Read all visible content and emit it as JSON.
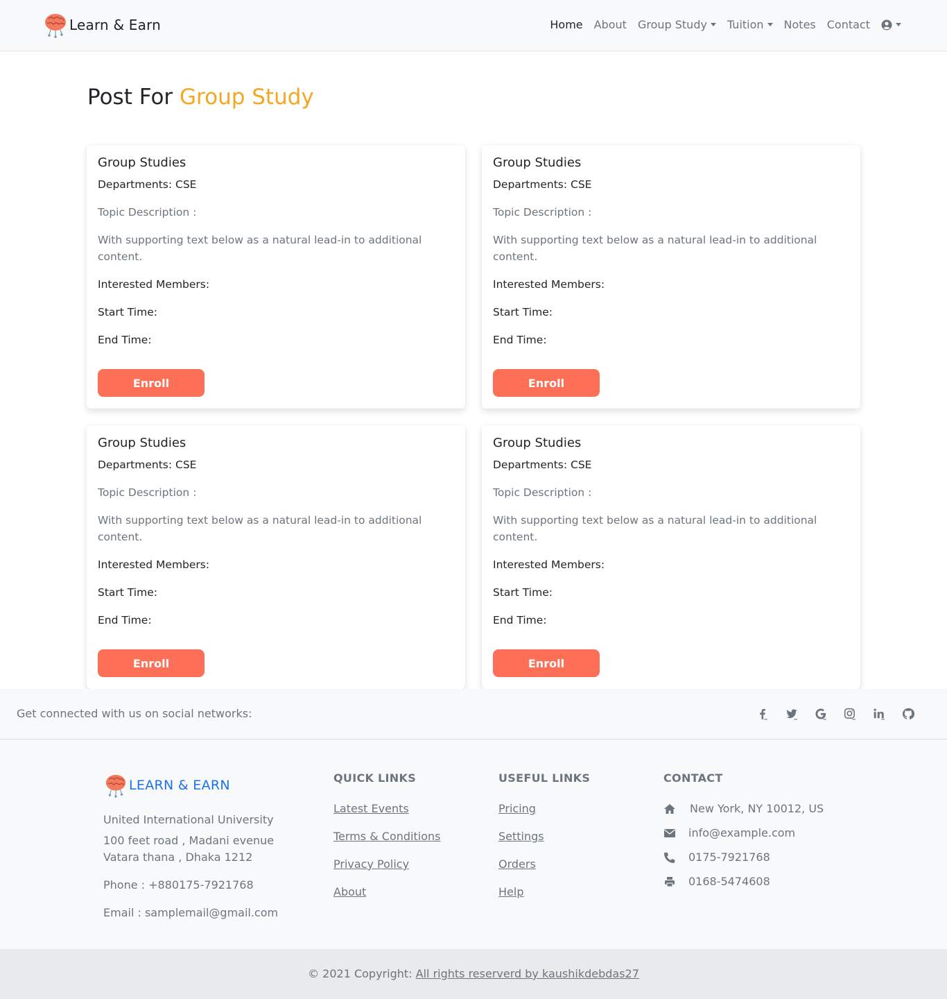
{
  "navbar": {
    "brand": "Learn & Earn",
    "links": [
      "Home",
      "About",
      "Group Study",
      "Tuition",
      "Notes",
      "Contact"
    ]
  },
  "page": {
    "title_prefix": "Post For",
    "title_accent": "Group Study",
    "accent_color": "#f5a623"
  },
  "cards": [
    {
      "title": "Group Studies",
      "department": "Departments: CSE",
      "topic_label": "Topic Description :",
      "description": "With supporting text below as a natural lead-in to additional content.",
      "members_label": "Interested Members:",
      "start_label": "Start Time:",
      "end_label": "End Time:",
      "button": "Enroll"
    },
    {
      "title": "Group Studies",
      "department": "Departments: CSE",
      "topic_label": "Topic Description :",
      "description": "With supporting text below as a natural lead-in to additional content.",
      "members_label": "Interested Members:",
      "start_label": "Start Time:",
      "end_label": "End Time:",
      "button": "Enroll"
    },
    {
      "title": "Group Studies",
      "department": "Departments: CSE",
      "topic_label": "Topic Description :",
      "description": "With supporting text below as a natural lead-in to additional content.",
      "members_label": "Interested Members:",
      "start_label": "Start Time:",
      "end_label": "End Time:",
      "button": "Enroll"
    },
    {
      "title": "Group Studies",
      "department": "Departments: CSE",
      "topic_label": "Topic Description :",
      "description": "With supporting text below as a natural lead-in to additional content.",
      "members_label": "Interested Members:",
      "start_label": "Start Time:",
      "end_label": "End Time:",
      "button": "Enroll"
    }
  ],
  "button_color": "#fd6f56",
  "social": {
    "text": "Get connected with us on social networks:",
    "icons": [
      "facebook-icon",
      "twitter-icon",
      "google-icon",
      "instagram-icon",
      "linkedin-icon",
      "github-icon"
    ]
  },
  "footer": {
    "brand": "LEARN & EARN",
    "brand_color": "#1a73e8",
    "address_lines": [
      "United International University",
      "100 feet road , Madani evenue",
      "Vatara thana , Dhaka 1212"
    ],
    "phone": "Phone : +880175-7921768",
    "email": "Email : samplemail@gmail.com",
    "quick_links": {
      "heading": "QUICK LINKS",
      "items": [
        "Latest Events",
        "Terms & Conditions",
        "Privacy Policy",
        "About"
      ]
    },
    "useful_links": {
      "heading": "USEFUL LINKS",
      "items": [
        "Pricing",
        "Settings",
        "Orders",
        "Help"
      ]
    },
    "contact": {
      "heading": "CONTACT",
      "items": [
        {
          "icon": "home-icon",
          "text": "New York, NY 10012, US"
        },
        {
          "icon": "envelope-icon",
          "text": "info@example.com"
        },
        {
          "icon": "phone-icon",
          "text": "0175-7921768"
        },
        {
          "icon": "printer-icon",
          "text": "0168-5474608"
        }
      ]
    }
  },
  "copyright": {
    "prefix": "© 2021 Copyright:",
    "link": "All rights reserverd by kaushikdebdas27"
  }
}
